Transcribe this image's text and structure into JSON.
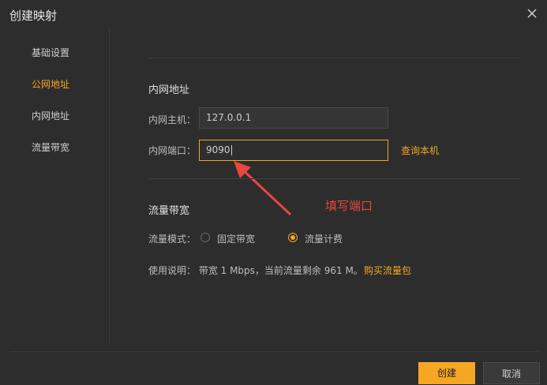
{
  "window": {
    "title": "创建映射"
  },
  "sidebar": {
    "items": [
      {
        "label": "基础设置"
      },
      {
        "label": "公网地址"
      },
      {
        "label": "内网地址"
      },
      {
        "label": "流量带宽"
      }
    ],
    "active_index": 1
  },
  "intranet": {
    "section_title": "内网地址",
    "host_label": "内网主机：",
    "host_value": "127.0.0.1",
    "port_label": "内网端口：",
    "port_value": "9090",
    "query_link": "查询本机"
  },
  "annotation": {
    "text": "填写端口",
    "color": "#e8463f"
  },
  "bandwidth": {
    "section_title": "流量带宽",
    "mode_label": "流量模式：",
    "options": [
      {
        "label": "固定带宽",
        "checked": false
      },
      {
        "label": "流量计费",
        "checked": true
      }
    ],
    "usage_text": "使用说明：  带宽 1 Mbps，当前流量剩余 961 M。",
    "buy_link": "购买流量包"
  },
  "footer": {
    "create_label": "创建",
    "cancel_label": "取消"
  },
  "colors": {
    "accent": "#f5a623",
    "background": "#2d2d2d",
    "annotation": "#e8463f"
  }
}
